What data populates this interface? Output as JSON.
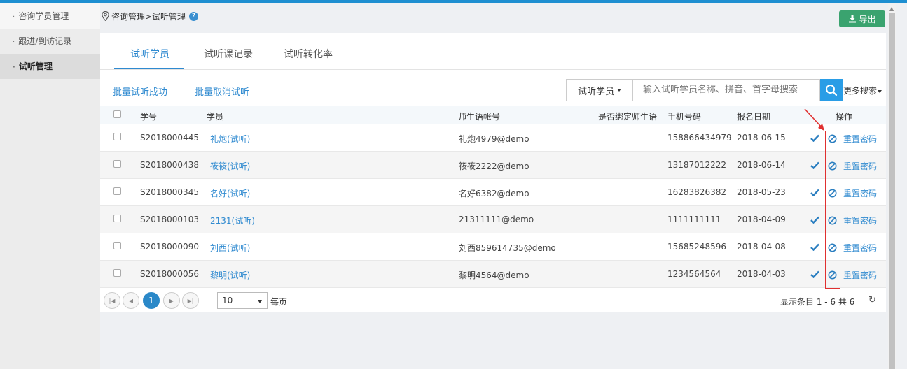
{
  "sidebar": {
    "items": [
      {
        "label": "咨询学员管理"
      },
      {
        "label": "跟进/到访记录"
      },
      {
        "label": "试听管理"
      }
    ]
  },
  "breadcrumb": {
    "text": "咨询管理>试听管理",
    "help": "?"
  },
  "toolbar": {
    "export_label": "导出"
  },
  "tabs": [
    {
      "label": "试听学员"
    },
    {
      "label": "试听课记录"
    },
    {
      "label": "试听转化率"
    }
  ],
  "actions": {
    "batch_success": "批量试听成功",
    "batch_cancel": "批量取消试听"
  },
  "search": {
    "type_label": "试听学员",
    "placeholder": "输入试听学员名称、拼音、首字母搜索",
    "more_label": "更多搜索"
  },
  "table": {
    "headers": {
      "id": "学号",
      "student": "学员",
      "account": "师生语帐号",
      "bound": "是否绑定师生语",
      "phone": "手机号码",
      "date": "报名日期",
      "ops": "操作"
    },
    "rows": [
      {
        "id": "S2018000445",
        "name": "礼炮(试听)",
        "account": "礼炮4979@demo",
        "phone": "158866434979",
        "date": "2018-06-15",
        "reset": "重置密码"
      },
      {
        "id": "S2018000438",
        "name": "筱筱(试听)",
        "account": "筱筱2222@demo",
        "phone": "13187012222",
        "date": "2018-06-14",
        "reset": "重置密码"
      },
      {
        "id": "S2018000345",
        "name": "名好(试听)",
        "account": "名好6382@demo",
        "phone": "16283826382",
        "date": "2018-05-23",
        "reset": "重置密码"
      },
      {
        "id": "S2018000103",
        "name": "2131(试听)",
        "account": "21311111@demo",
        "phone": "1111111111",
        "date": "2018-04-09",
        "reset": "重置密码"
      },
      {
        "id": "S2018000090",
        "name": "刘西(试听)",
        "account": "刘西859614735@demo",
        "phone": "15685248596",
        "date": "2018-04-08",
        "reset": "重置密码"
      },
      {
        "id": "S2018000056",
        "name": "黎明(试听)",
        "account": "黎明4564@demo",
        "phone": "1234564564",
        "date": "2018-04-03",
        "reset": "重置密码"
      }
    ]
  },
  "pager": {
    "current_page": "1",
    "page_size": "10",
    "per_page_label": "每页",
    "summary": "显示条目 1 - 6 共 6"
  },
  "colors": {
    "accent": "#2f8ad0",
    "export": "#3aa36f",
    "highlight": "#e03030"
  }
}
